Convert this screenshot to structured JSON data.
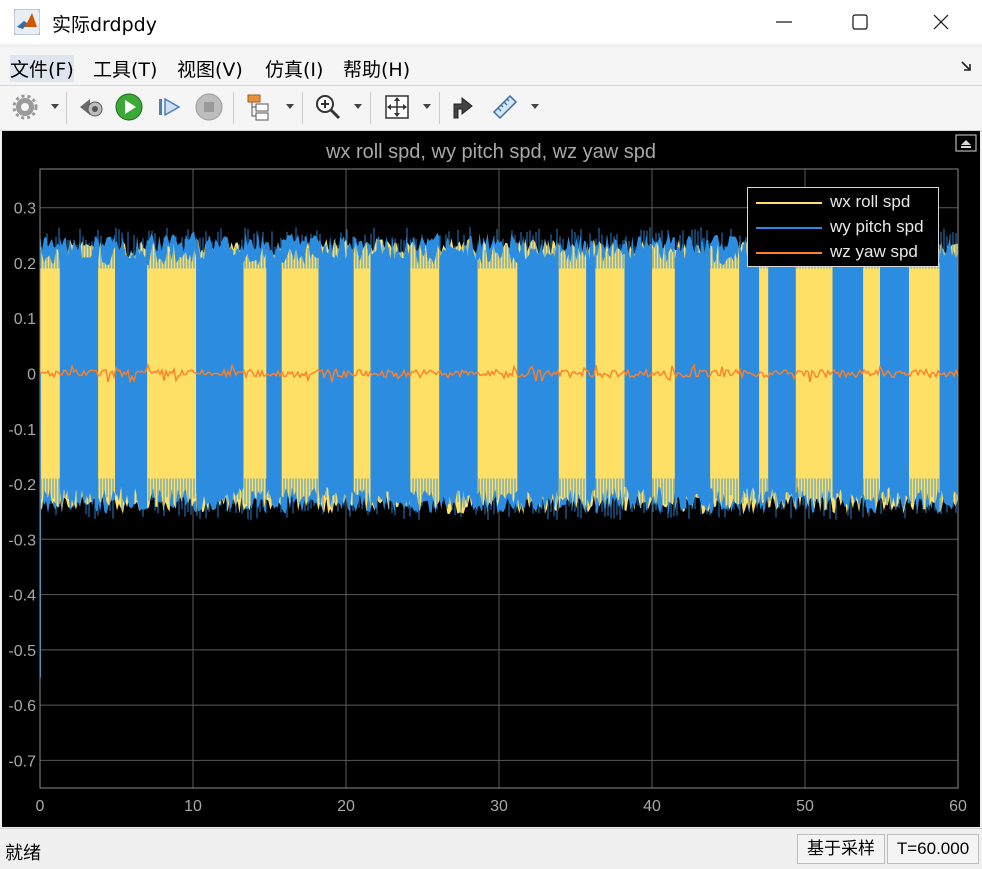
{
  "window": {
    "title": "实际drdpdy"
  },
  "menu": {
    "items": [
      "文件(F)",
      "工具(T)",
      "视图(V)",
      "仿真(I)",
      "帮助(H)"
    ]
  },
  "toolbar": {
    "icons": [
      "gear-icon",
      "step-back-icon",
      "run-icon",
      "step-forward-icon",
      "stop-icon",
      "signal-hierarchy-icon",
      "zoom-in-icon",
      "fit-to-view-icon",
      "highlight-in-model-icon",
      "measure-icon"
    ]
  },
  "status": {
    "text": "就绪",
    "mode": "基于采样",
    "time": "T=60.000"
  },
  "colors": {
    "scope_background": "#000000",
    "grid": "#5a5a5a",
    "series_wx": "#ffe066",
    "series_wy": "#2b8ce0",
    "series_wz": "#ff7f27"
  },
  "chart_data": {
    "type": "line",
    "title": "wx roll spd, wy pitch spd, wz yaw spd",
    "xlabel": "",
    "ylabel": "",
    "xlim": [
      0,
      60
    ],
    "ylim": [
      -0.75,
      0.37
    ],
    "x_ticks": [
      "0",
      "10",
      "20",
      "30",
      "40",
      "50",
      "60"
    ],
    "y_ticks": [
      "0.3",
      "0.2",
      "0.1",
      "0",
      "-0.1",
      "-0.2",
      "-0.3",
      "-0.4",
      "-0.5",
      "-0.6",
      "-0.7"
    ],
    "grid": true,
    "legend_position": "top-right",
    "series": [
      {
        "name": "wx roll spd",
        "color": "#ffe066",
        "envelope": [
          -0.25,
          0.24
        ]
      },
      {
        "name": "wy pitch spd",
        "color": "#2b8ce0",
        "envelope": [
          -0.25,
          0.25
        ]
      },
      {
        "name": "wz yaw spd",
        "color": "#ff7f27",
        "envelope": [
          -0.01,
          0.01
        ]
      }
    ],
    "dominant_bands": [
      {
        "x": [
          0,
          1.3
        ],
        "top": "wx roll spd"
      },
      {
        "x": [
          1.3,
          3.8
        ],
        "top": "wy pitch spd"
      },
      {
        "x": [
          3.8,
          4.9
        ],
        "top": "wx roll spd"
      },
      {
        "x": [
          4.9,
          7.0
        ],
        "top": "wy pitch spd"
      },
      {
        "x": [
          7.0,
          10.2
        ],
        "top": "wx roll spd"
      },
      {
        "x": [
          10.2,
          13.3
        ],
        "top": "wy pitch spd"
      },
      {
        "x": [
          13.3,
          14.8
        ],
        "top": "wx roll spd"
      },
      {
        "x": [
          14.8,
          15.8
        ],
        "top": "wy pitch spd"
      },
      {
        "x": [
          15.8,
          18.2
        ],
        "top": "wx roll spd"
      },
      {
        "x": [
          18.2,
          20.5
        ],
        "top": "wy pitch spd"
      },
      {
        "x": [
          20.5,
          21.6
        ],
        "top": "wx roll spd"
      },
      {
        "x": [
          21.6,
          24.2
        ],
        "top": "wy pitch spd"
      },
      {
        "x": [
          24.2,
          26.1
        ],
        "top": "wx roll spd"
      },
      {
        "x": [
          26.1,
          28.6
        ],
        "top": "wy pitch spd"
      },
      {
        "x": [
          28.6,
          31.2
        ],
        "top": "wx roll spd"
      },
      {
        "x": [
          31.2,
          33.9
        ],
        "top": "wy pitch spd"
      },
      {
        "x": [
          33.9,
          35.7
        ],
        "top": "wx roll spd"
      },
      {
        "x": [
          35.7,
          36.3
        ],
        "top": "wy pitch spd"
      },
      {
        "x": [
          36.3,
          38.2
        ],
        "top": "wx roll spd"
      },
      {
        "x": [
          38.2,
          40.0
        ],
        "top": "wy pitch spd"
      },
      {
        "x": [
          40.0,
          41.5
        ],
        "top": "wx roll spd"
      },
      {
        "x": [
          41.5,
          43.8
        ],
        "top": "wy pitch spd"
      },
      {
        "x": [
          43.8,
          45.7
        ],
        "top": "wx roll spd"
      },
      {
        "x": [
          45.7,
          47.0
        ],
        "top": "wy pitch spd"
      },
      {
        "x": [
          47.0,
          47.6
        ],
        "top": "wx roll spd"
      },
      {
        "x": [
          47.6,
          49.4
        ],
        "top": "wy pitch spd"
      },
      {
        "x": [
          49.4,
          51.8
        ],
        "top": "wx roll spd"
      },
      {
        "x": [
          51.8,
          53.8
        ],
        "top": "wy pitch spd"
      },
      {
        "x": [
          53.8,
          54.9
        ],
        "top": "wx roll spd"
      },
      {
        "x": [
          54.9,
          56.8
        ],
        "top": "wy pitch spd"
      },
      {
        "x": [
          56.8,
          58.8
        ],
        "top": "wx roll spd"
      },
      {
        "x": [
          58.8,
          60.0
        ],
        "top": "wy pitch spd"
      }
    ]
  }
}
